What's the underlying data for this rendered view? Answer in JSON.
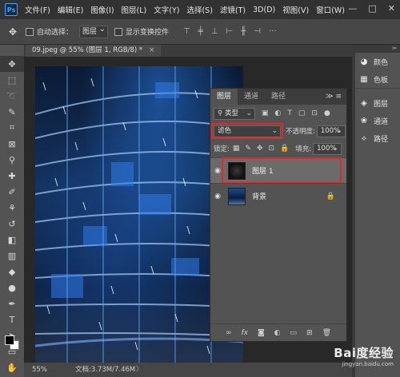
{
  "app": {
    "logo": "Ps"
  },
  "menu": [
    "文件(F)",
    "编辑(E)",
    "图像(I)",
    "图层(L)",
    "文字(Y)",
    "选择(S)",
    "滤镜(T)",
    "3D(D)",
    "视图(V)",
    "窗口(W)"
  ],
  "window_controls": {
    "minimize": "—",
    "maximize": "□",
    "close": "✕"
  },
  "options_bar": {
    "move_icon": "✥",
    "auto_select_label": "自动选择：",
    "auto_select_value": "图层",
    "transform_label": "显示变换控件"
  },
  "document_tab": {
    "title": "09.jpeg @ 55% (图层 1, RGB/8) *",
    "close": "×"
  },
  "status": {
    "zoom": "55%",
    "doc_size": "文档:3.73M/7.46M",
    "arrow": "〉"
  },
  "layers_panel": {
    "tabs": [
      "图层",
      "通道",
      "路径"
    ],
    "menu_glyph": "≫ ≡",
    "filter_label": "类型",
    "blend_mode": "滤色",
    "opacity_label": "不透明度:",
    "opacity_value": "100%",
    "lock_label": "锁定:",
    "fill_label": "填充:",
    "fill_value": "100%",
    "layers": [
      {
        "name": "图层 1",
        "selected": true,
        "locked": false
      },
      {
        "name": "背景",
        "selected": false,
        "locked": true
      }
    ]
  },
  "dock": {
    "group1": [
      {
        "icon": "palette-icon",
        "label": "颜色"
      },
      {
        "icon": "swatches-icon",
        "label": "色板"
      }
    ],
    "group2": [
      {
        "icon": "layers-icon",
        "label": "图层"
      },
      {
        "icon": "channels-icon",
        "label": "通道"
      },
      {
        "icon": "paths-icon",
        "label": "路径"
      }
    ]
  },
  "watermark": {
    "brand": "Bai度经验",
    "url": "jingyan.baidu.com"
  },
  "colors": {
    "highlight": "#e02a2a",
    "menubar": "#323232",
    "panel": "#535353"
  }
}
